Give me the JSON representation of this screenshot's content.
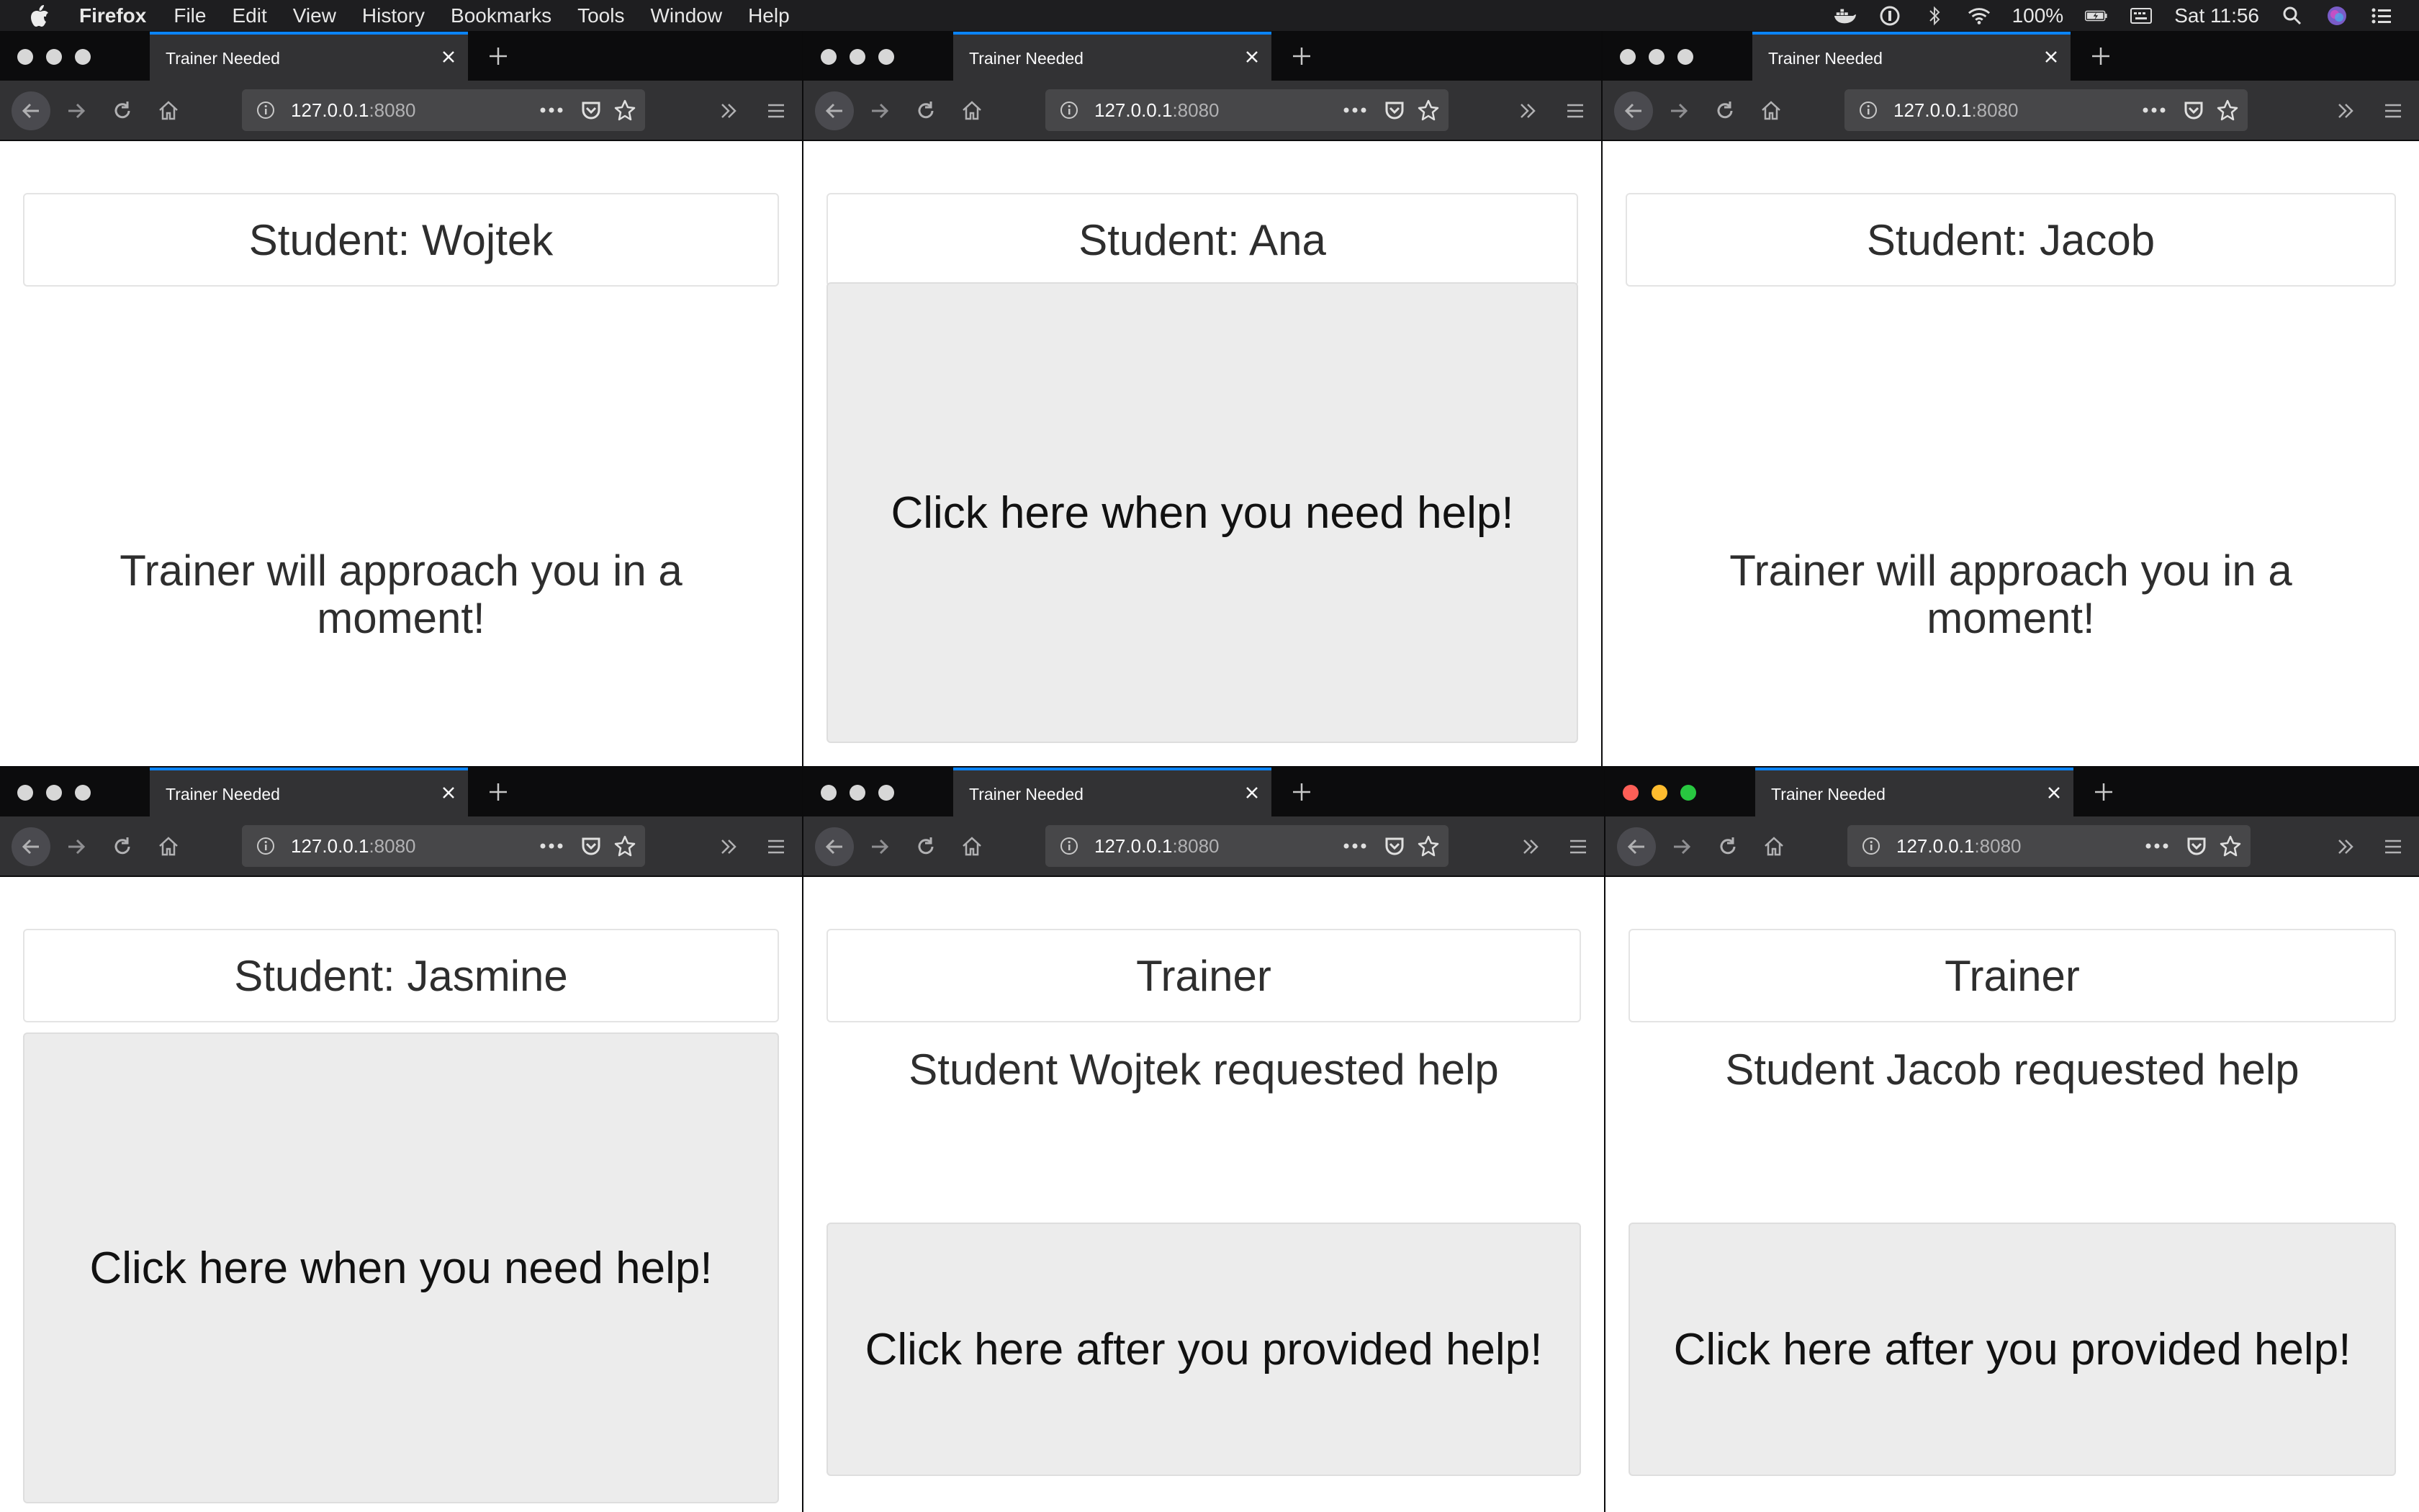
{
  "menubar": {
    "app_name": "Firefox",
    "items": [
      "File",
      "Edit",
      "View",
      "History",
      "Bookmarks",
      "Tools",
      "Window",
      "Help"
    ],
    "battery": "100%",
    "clock": "Sat 11:56",
    "status_icons": [
      "docker-icon",
      "password-manager-icon",
      "bluetooth-icon",
      "wifi-icon",
      "battery-icon",
      "keyboard-icon",
      "spotlight-search-icon",
      "siri-icon",
      "control-list-icon"
    ]
  },
  "browser": {
    "tab_title": "Trainer Needed",
    "url_host": "127.0.0.1",
    "url_port": ":8080"
  },
  "windows": [
    {
      "header": "Student: Wojtek",
      "status": "Trainer will approach you in a moment!",
      "button": ""
    },
    {
      "header": "Student: Ana",
      "status": "",
      "button": "Click here when you need help!"
    },
    {
      "header": "Student: Jacob",
      "status": "Trainer will approach you in a moment!",
      "button": ""
    },
    {
      "header": "Student: Jasmine",
      "status": "",
      "button": "Click here when you need help!"
    },
    {
      "header": "Trainer",
      "status": "Student Wojtek requested help",
      "button": "Click here after you provided help!"
    },
    {
      "header": "Trainer",
      "status": "Student Jacob requested help",
      "button": "Click here after you provided help!"
    }
  ],
  "colors": {
    "tab_accent": "#0a84ff",
    "toolbar": "#323234",
    "tabbar": "#0c0c0d",
    "button_bg": "#ececec"
  }
}
